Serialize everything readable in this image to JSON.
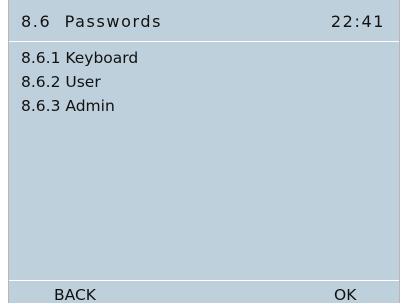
{
  "header": {
    "title": "8.6  Passwords",
    "clock": "22:41"
  },
  "menu": {
    "items": [
      {
        "label": "8.6.1 Keyboard"
      },
      {
        "label": "8.6.2 User"
      },
      {
        "label": "8.6.3 Admin"
      }
    ]
  },
  "softkeys": {
    "left_label": "BACK",
    "right_label": "OK"
  },
  "colors": {
    "screen_background": "#bdd0dc",
    "text": "#111111",
    "divider": "#ffffff"
  }
}
